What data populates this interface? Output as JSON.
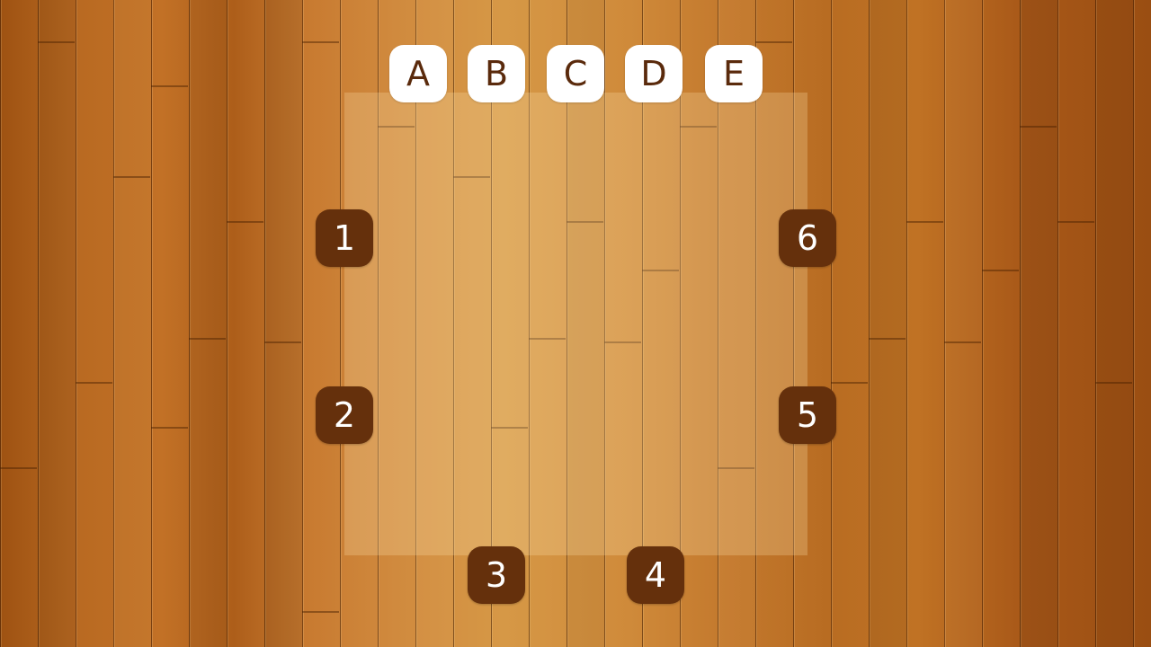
{
  "letters": [
    {
      "label": "A"
    },
    {
      "label": "B"
    },
    {
      "label": "C"
    },
    {
      "label": "D"
    },
    {
      "label": "E"
    }
  ],
  "numbers": [
    {
      "label": "1"
    },
    {
      "label": "2"
    },
    {
      "label": "3"
    },
    {
      "label": "4"
    },
    {
      "label": "5"
    },
    {
      "label": "6"
    }
  ],
  "colors": {
    "letter_tile_bg": "#ffffff",
    "letter_text": "#5a2a0c",
    "number_tile_bg": "#65300c",
    "number_text": "#ffffff"
  }
}
